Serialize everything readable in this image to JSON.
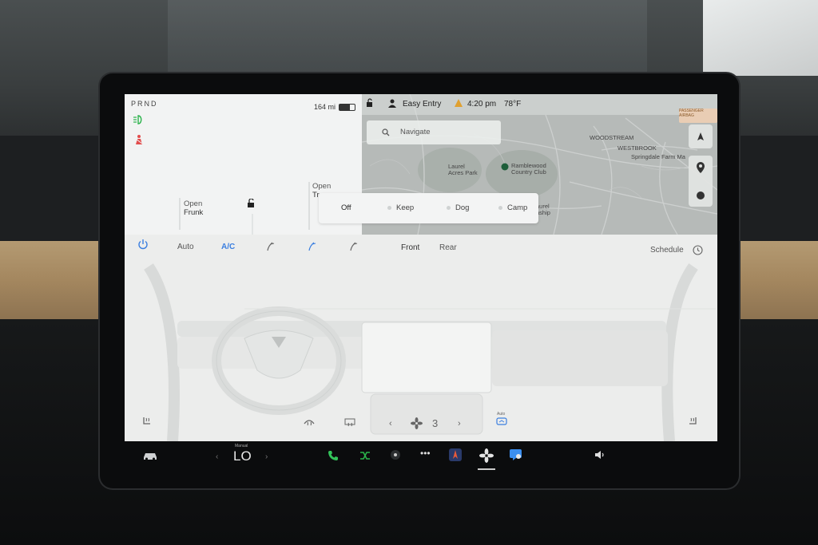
{
  "status": {
    "gears": "PRND",
    "range": "164 mi",
    "driver_profile": "Easy Entry",
    "time": "4:20 pm",
    "temperature": "78°F"
  },
  "doors": {
    "frunk_action": "Open",
    "frunk_label": "Frunk",
    "trunk_action": "Open",
    "trunk_label": "Tr"
  },
  "map": {
    "search_placeholder": "Navigate",
    "labels": {
      "laurel_acres": "Laurel\nAcres Park",
      "ramblewood": "Ramblewood\nCountry Club",
      "woodstream": "WOODSTREAM",
      "westbrook": "WESTBROOK",
      "springdale": "Springdale Farm Ma",
      "laurel_ship": "aurel\nnship"
    },
    "airbag_text": "PASSENGER\nAIRBAG"
  },
  "camp_mode": {
    "options": [
      "Off",
      "Keep",
      "Dog",
      "Camp"
    ],
    "selected": "Off"
  },
  "climate": {
    "auto_label": "Auto",
    "ac_label": "A/C",
    "front_label": "Front",
    "rear_label": "Rear",
    "schedule_label": "Schedule",
    "fan_speed": "3",
    "seat_heat_left_label": "Seat heat",
    "auto_small_label": "Auto"
  },
  "taskbar": {
    "temp_mode": "Manual",
    "temp_value": "LO",
    "more": "•••"
  },
  "colors": {
    "accent_blue": "#3b7fe0",
    "indicator_green": "#2bb34b",
    "warning_red": "#e24d4d",
    "phone_green": "#33c45a"
  }
}
